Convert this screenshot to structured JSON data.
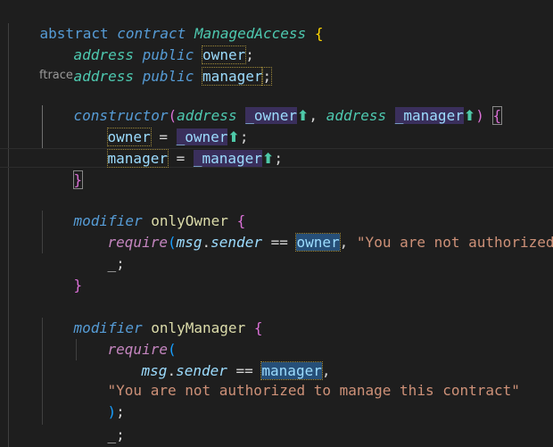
{
  "editor": {
    "codelens": "ftrace",
    "lines": {
      "contract_decl": {
        "kw": "abstract",
        "kw2": "contract",
        "name": "ManagedAccess",
        "open": "{"
      },
      "owner_decl": {
        "type": "address",
        "vis": "public",
        "name": "owner",
        "semi": ";"
      },
      "manager_decl": {
        "type": "address",
        "vis": "public",
        "name": "manager",
        "semi": ";"
      },
      "ctor": {
        "kw": "constructor",
        "open": "(",
        "type1": "address",
        "p1": "_owner",
        "comma": ", ",
        "type2": "address",
        "p2": "_manager",
        "close": ")",
        "brace": "{"
      },
      "ctor_owner": {
        "lhs": "owner",
        "eq": " = ",
        "rhs": "_owner",
        "semi": ";"
      },
      "ctor_manager": {
        "lhs": "manager",
        "eq": " = ",
        "rhs": "_manager",
        "semi": ";"
      },
      "ctor_close": {
        "brace": "}"
      },
      "mod_owner": {
        "kw": "modifier",
        "name": "onlyOwner",
        "brace": "{"
      },
      "req_owner": {
        "fn": "require",
        "open": "(",
        "obj": "msg",
        "dot": ".",
        "prop": "sender",
        "op": " == ",
        "var": "owner",
        "comma": ", ",
        "msg": "\"You are not authorized\"",
        "close": ")",
        "semi": ";"
      },
      "placeholder1": {
        "text": "_;"
      },
      "mod_owner_close": {
        "brace": "}"
      },
      "mod_manager": {
        "kw": "modifier",
        "name": "onlyManager",
        "brace": "{"
      },
      "req_manager_open": {
        "fn": "require",
        "open": "("
      },
      "req_manager_cond": {
        "obj": "msg",
        "dot": ".",
        "prop": "sender",
        "op": " == ",
        "var": "manager",
        "comma": ","
      },
      "req_manager_msg": {
        "msg": "\"You are not authorized to manage this contract\""
      },
      "req_manager_close": {
        "close": ")",
        "semi": ";"
      },
      "placeholder2": {
        "text": "_;"
      },
      "mod_manager_close": {
        "brace": "}"
      }
    },
    "arrow_glyph": "⬆"
  },
  "colors": {
    "background": "#1e1e1e",
    "keyword": "#569cd6",
    "type": "#4ec9b0",
    "function": "#dcdcaa",
    "variable": "#9cdcfe",
    "control": "#c586c0",
    "string": "#ce9178",
    "bracket_gold": "#ffd700",
    "bracket_orchid": "#da70d6",
    "bracket_blue": "#179fff"
  }
}
